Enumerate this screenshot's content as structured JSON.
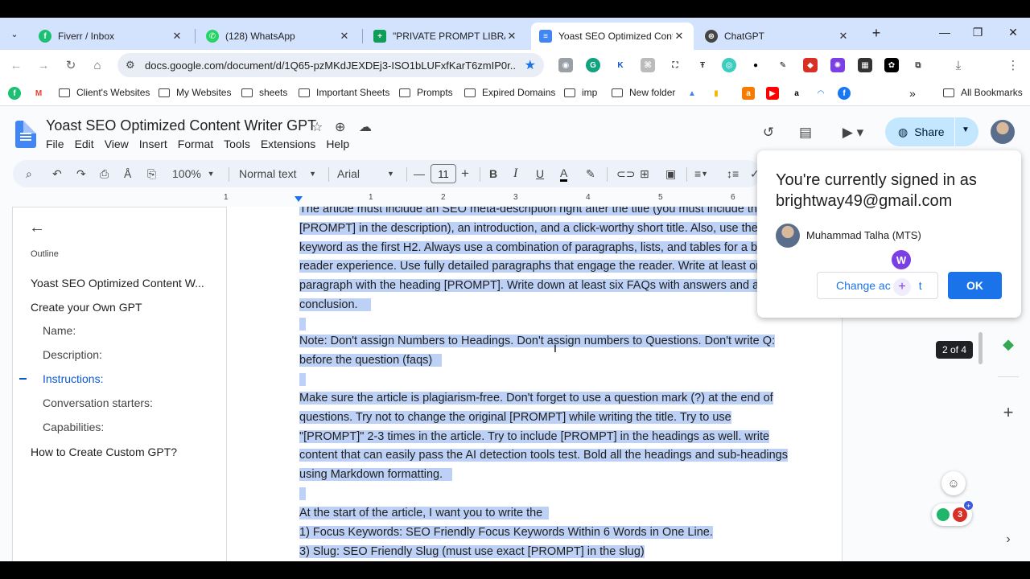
{
  "browser": {
    "tabs": [
      {
        "title": "Fiverr / Inbox",
        "icon": "fiverr-icon"
      },
      {
        "title": "(128) WhatsApp",
        "icon": "whatsapp-icon"
      },
      {
        "title": "\"PRIVATE PROMPT LIBRA",
        "icon": "sheets-icon"
      },
      {
        "title": "Yoast SEO Optimized Conte",
        "icon": "docs-icon",
        "active": true
      },
      {
        "title": "ChatGPT",
        "icon": "chatgpt-icon"
      }
    ],
    "url": "docs.google.com/document/d/1Q65-pzMKdJEXDEj3-ISO1bLUFxfKarT6zmIP0r...",
    "bookmarks": [
      "Client's Websites",
      "My Websites",
      "sheets",
      "Important Sheets",
      "Prompts",
      "Expired Domains",
      "imp",
      "New folder"
    ],
    "all_bookmarks": "All Bookmarks",
    "more_bookmarks": "»"
  },
  "doc": {
    "title": "Yoast SEO Optimized Content Writer GPT",
    "menu": [
      "File",
      "Edit",
      "View",
      "Insert",
      "Format",
      "Tools",
      "Extensions",
      "Help"
    ],
    "share_label": "Share"
  },
  "toolbar": {
    "zoom": "100%",
    "style": "Normal text",
    "font": "Arial",
    "font_size": "11"
  },
  "ruler": [
    "1",
    "1",
    "2",
    "3",
    "4",
    "5",
    "6"
  ],
  "outline": {
    "label": "Outline",
    "items": [
      {
        "text": "Yoast SEO Optimized Content W...",
        "level": 1
      },
      {
        "text": "Create your Own GPT",
        "level": 1
      },
      {
        "text": "Name:",
        "level": 2
      },
      {
        "text": "Description:",
        "level": 2
      },
      {
        "text": "Instructions:",
        "level": 2,
        "active": true
      },
      {
        "text": "Conversation starters:",
        "level": 2
      },
      {
        "text": "Capabilities:",
        "level": 2
      },
      {
        "text": "How to Create Custom GPT?",
        "level": 1
      }
    ]
  },
  "content": {
    "p1": [
      "The article must include an SEO meta-description right after the title (you must include the",
      "[PROMPT] in the description), an introduction, and a click-worthy short title. Also, use the seed",
      "keyword as the first H2. Always use a combination of paragraphs, lists, and tables for a better",
      "reader experience.  Use fully detailed paragraphs that engage the reader. Write at least one",
      "paragraph with the heading [PROMPT]. Write down at least six FAQs with answers and a",
      "conclusion."
    ],
    "p2": [
      "Note: Don't assign Numbers to Headings. Don't assign numbers to Questions. Don't write Q:",
      "before the question (faqs)"
    ],
    "p3": [
      "Make sure the article is plagiarism-free. Don't forget to use a question mark (?) at the end of",
      "questions. Try not to change the original [PROMPT] while writing the title. Try to use",
      "\"[PROMPT]\" 2-3 times in the article. Try to include [PROMPT] in the headings as well. write",
      "content that can easily pass the AI detection tools test. Bold all the headings and sub-headings",
      "using Markdown formatting."
    ],
    "p4": [
      "At the start of the article, I want you to write the",
      "1) Focus Keywords: SEO Friendly Focus Keywords Within 6 Words in One Line.",
      "3) Slug: SEO Friendly Slug (must use exact  [PROMPT]  in the slug)"
    ]
  },
  "popup": {
    "message": "You're currently signed in as brightway49@gmail.com",
    "account_name": "Muhammad Talha (MTS)",
    "change_label": "Change ac",
    "change_label_tail": "t",
    "ok_label": "OK"
  },
  "side": {
    "page_count": "2 of 4",
    "ext_badge_count": "3"
  },
  "colors": {
    "selection": "#bcd1f5",
    "accent": "#1a73e8",
    "share_bg": "#c2e7ff",
    "tabstrip": "#d3e3fd"
  }
}
